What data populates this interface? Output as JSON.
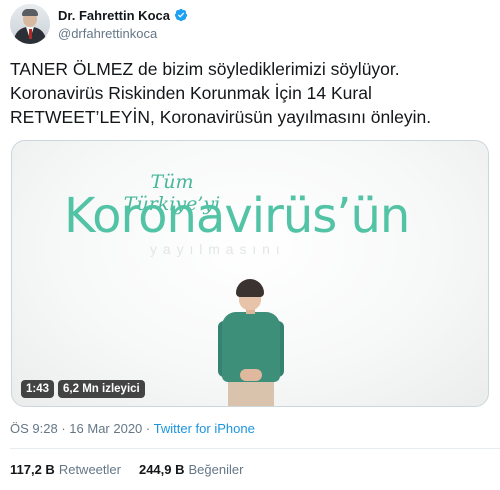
{
  "author": {
    "display_name": "Dr. Fahrettin Koca",
    "handle": "@drfahrettinkoca",
    "verified_icon": "verified-badge-icon",
    "verified_color": "#1da1f2"
  },
  "tweet": {
    "lines": [
      "TANER ÖLMEZ de bizim söylediklerimizi söylüyor.",
      "Koronavirüs Riskinden Korunmak İçin 14 Kural",
      "RETWEET’LEYİN, Koronavirüsün yayılmasını önleyin."
    ]
  },
  "video": {
    "script_line": "Tüm Türkiye’yi",
    "headline": "Koronavirüs’ün",
    "duration": "1:43",
    "views": "6,2 Mn izleyici",
    "accent_color": "#52c3a5"
  },
  "meta": {
    "time": "ÖS 9:28",
    "separator1": "·",
    "date": "16 Mar 2020",
    "separator2": "·",
    "source": "Twitter for iPhone"
  },
  "stats": {
    "retweets_count": "117,2 B",
    "retweets_label": "Retweetler",
    "likes_count": "244,9 B",
    "likes_label": "Beğeniler"
  }
}
